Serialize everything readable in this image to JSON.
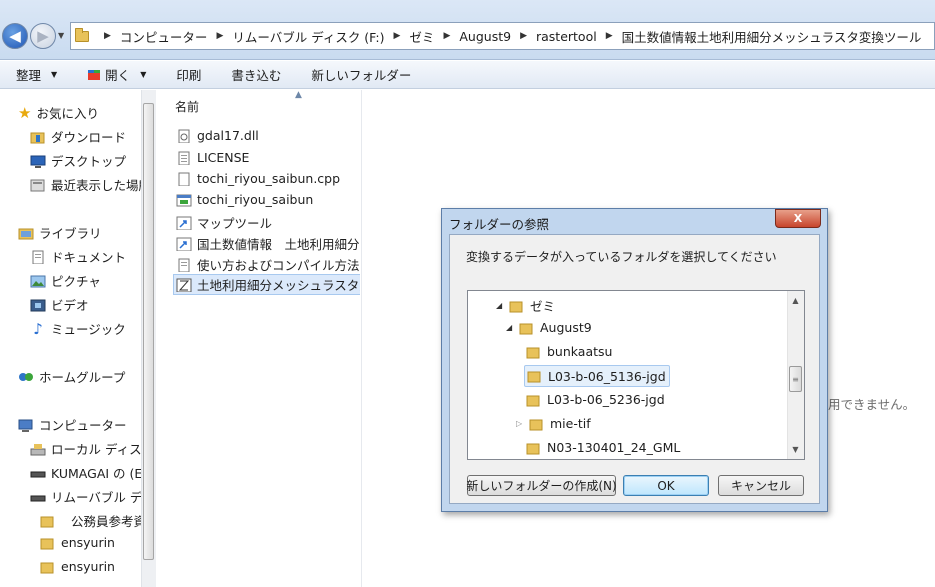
{
  "breadcrumb": [
    "コンピューター",
    "リムーバブル ディスク (F:)",
    "ゼミ",
    "August9",
    "rastertool",
    "国土数値情報土地利用細分メッシュラスタ変換ツール"
  ],
  "toolbar": {
    "organize": "整理",
    "open": "開く",
    "print": "印刷",
    "burn": "書き込む",
    "new_folder": "新しいフォルダー"
  },
  "nav": {
    "favorites": "お気に入り",
    "downloads": "ダウンロード",
    "desktop": "デスクトップ",
    "recent": "最近表示した場所",
    "libraries": "ライブラリ",
    "documents": "ドキュメント",
    "pictures": "ピクチャ",
    "videos": "ビデオ",
    "music": "ミュージック",
    "homegroup": "ホームグループ",
    "computer": "コンピューター",
    "local_disk": "ローカル ディスク",
    "kumagai": "KUMAGAI の (E",
    "removable": "リムーバブル デ",
    "koumuin": "公務員参考資",
    "ensyurin": "ensyurin",
    "cut": "ensyurin"
  },
  "filelist": {
    "header": "名前",
    "files": [
      "gdal17.dll",
      "LICENSE",
      "tochi_riyou_saibun.cpp",
      "tochi_riyou_saibun",
      "マップツール",
      "国土数値情報　土地利用細分メ",
      "使い方およびコンパイル方法",
      "土地利用細分メッシュラスタ変"
    ]
  },
  "empty_msg": "用できません。",
  "dialog": {
    "title": "フォルダーの参照",
    "close": "X",
    "description": "変換するデータが入っているフォルダを選択してください",
    "tree": [
      "ゼミ",
      "August9",
      "bunkaatsu",
      "L03-b-06_5136-jgd",
      "L03-b-06_5236-jgd",
      "mie-tif",
      "N03-130401_24_GML"
    ],
    "new_folder_btn": "新しいフォルダーの作成(N)",
    "ok_btn": "OK",
    "cancel_btn": "キャンセル"
  }
}
